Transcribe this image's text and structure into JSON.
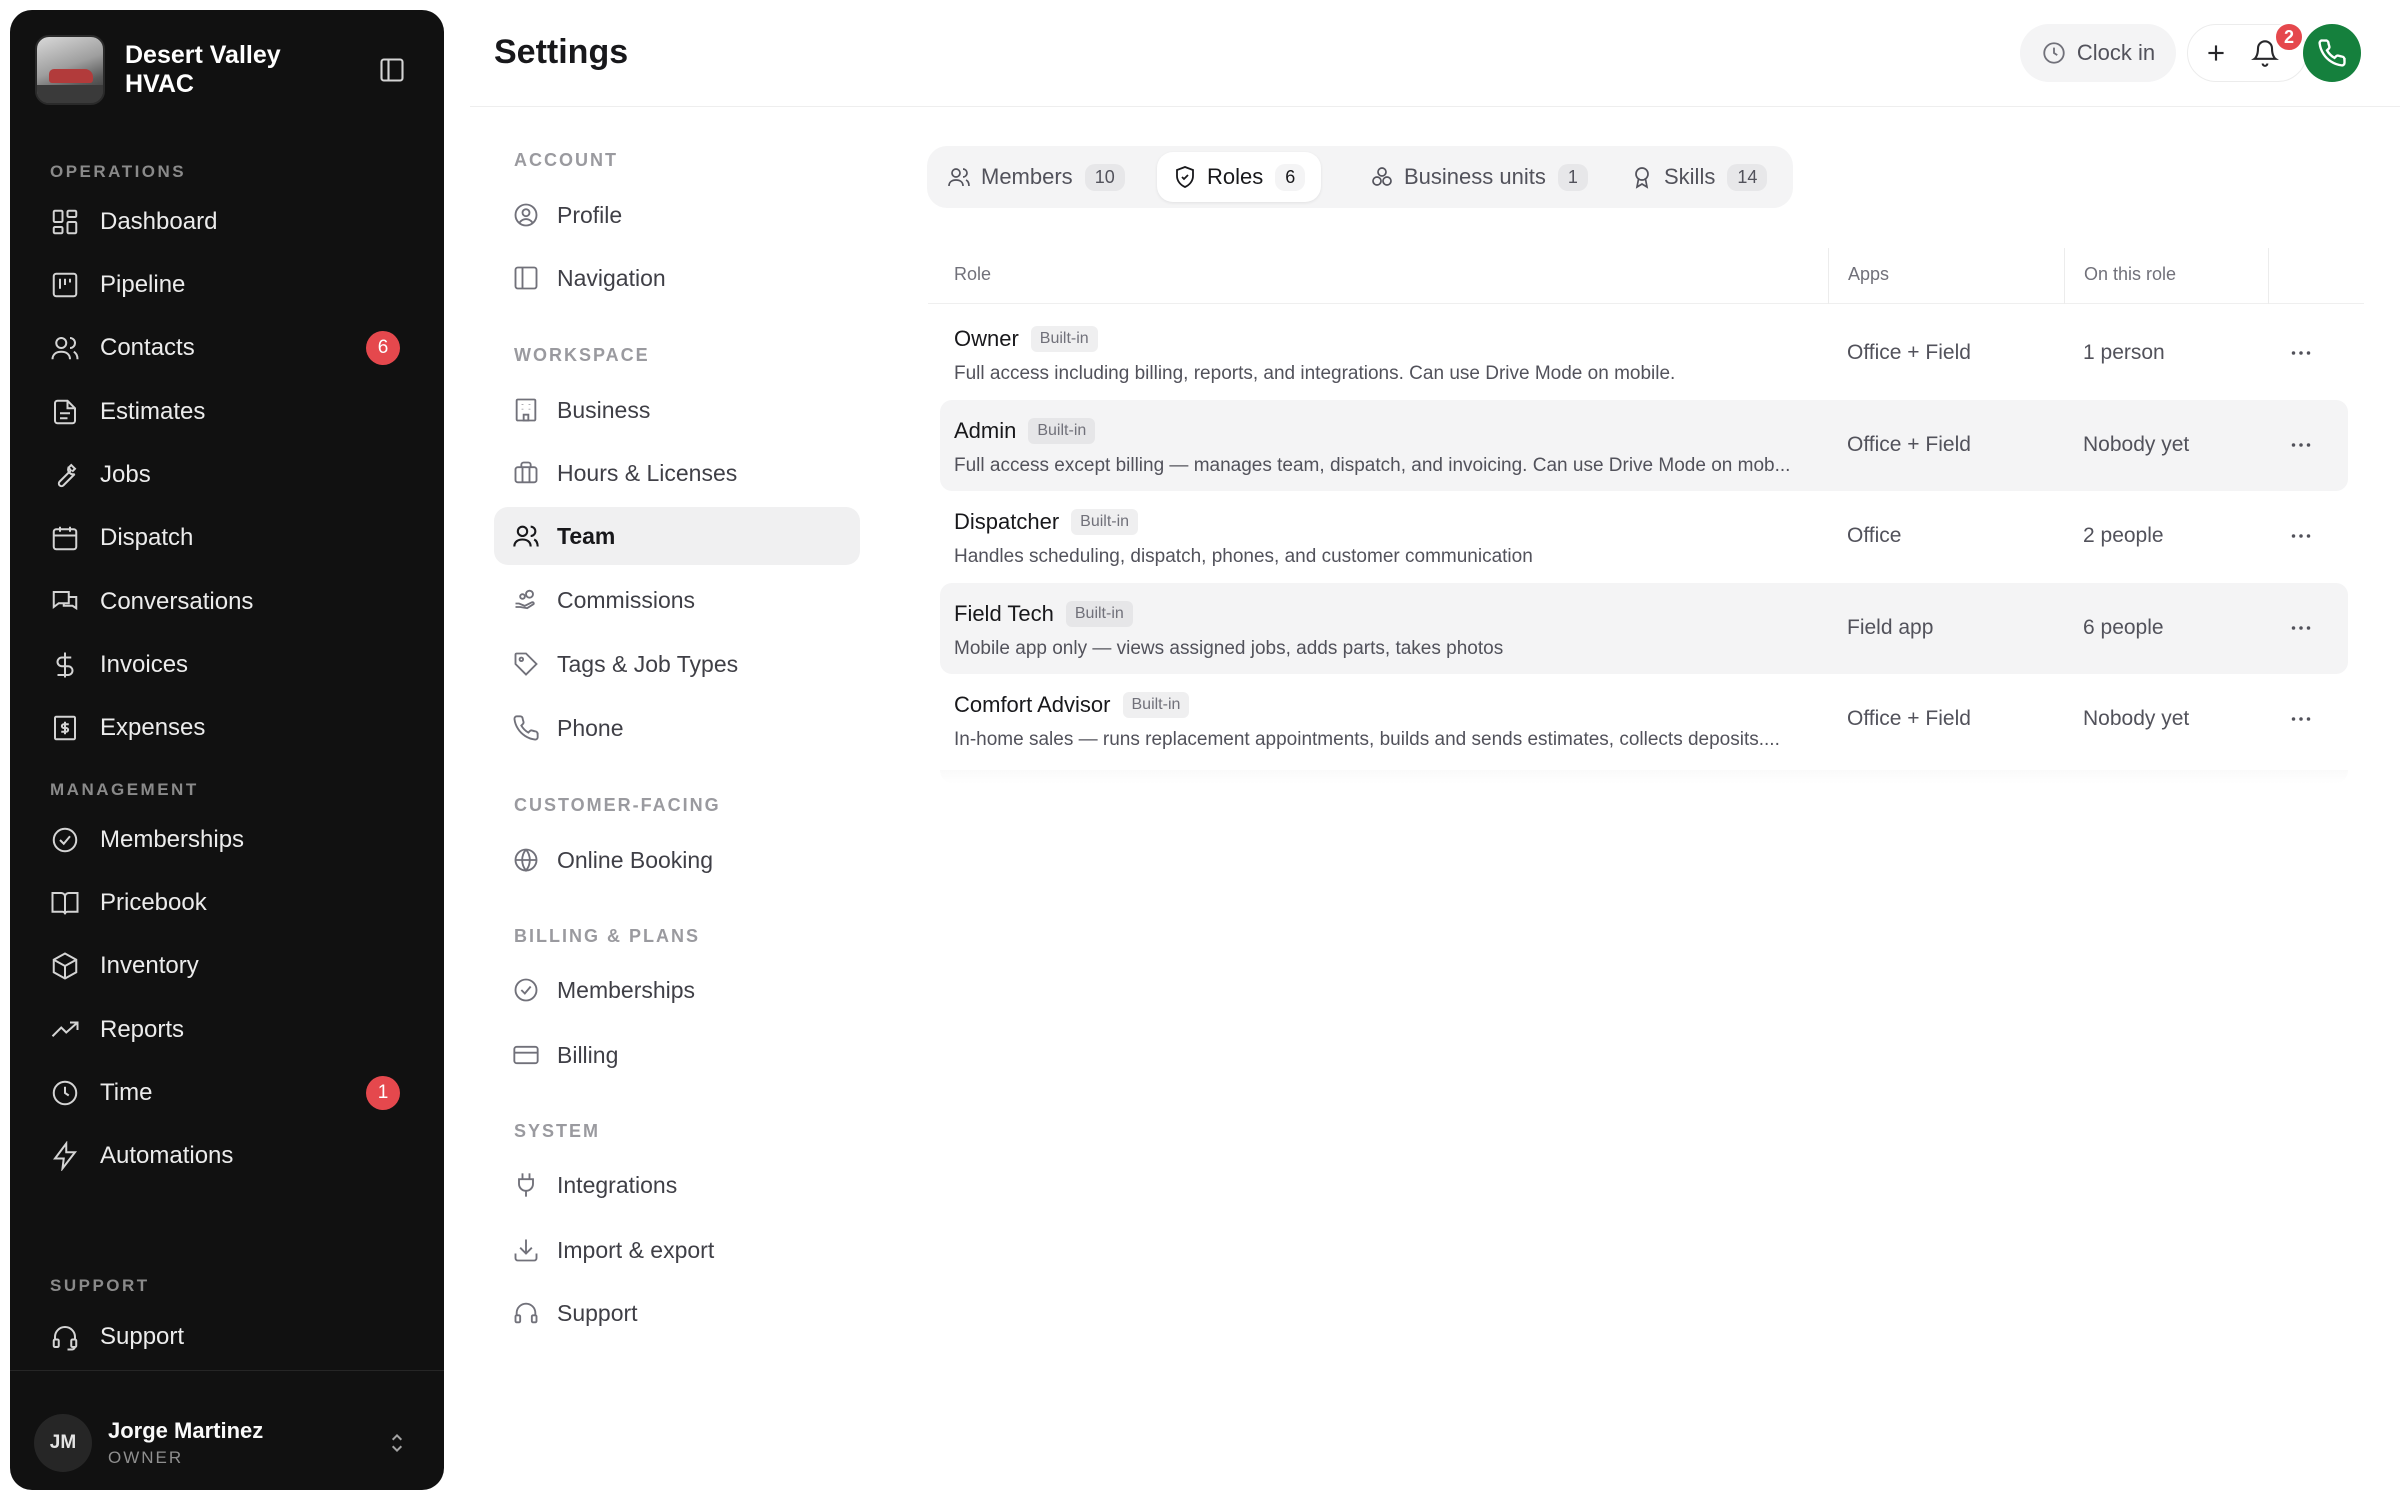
{
  "sidebar": {
    "brand_name": "Desert Valley HVAC",
    "sections": {
      "operations": "OPERATIONS",
      "management": "MANAGEMENT",
      "support": "SUPPORT"
    },
    "items": {
      "dashboard": "Dashboard",
      "pipeline": "Pipeline",
      "contacts": "Contacts",
      "contacts_badge": "6",
      "estimates": "Estimates",
      "jobs": "Jobs",
      "dispatch": "Dispatch",
      "conversations": "Conversations",
      "invoices": "Invoices",
      "expenses": "Expenses",
      "memberships": "Memberships",
      "pricebook": "Pricebook",
      "inventory": "Inventory",
      "reports": "Reports",
      "time": "Time",
      "time_badge": "1",
      "automations": "Automations",
      "support": "Support"
    },
    "user": {
      "initials": "JM",
      "name": "Jorge Martinez",
      "role": "OWNER"
    }
  },
  "header": {
    "title": "Settings",
    "clock_in": "Clock in",
    "notification_count": "2"
  },
  "settings_nav": {
    "sections": {
      "account": "ACCOUNT",
      "workspace": "WORKSPACE",
      "customer_facing": "CUSTOMER-FACING",
      "billing_plans": "BILLING & PLANS",
      "system": "SYSTEM"
    },
    "items": {
      "profile": "Profile",
      "navigation": "Navigation",
      "business": "Business",
      "hours_licenses": "Hours & Licenses",
      "team": "Team",
      "commissions": "Commissions",
      "tags_job_types": "Tags & Job Types",
      "phone": "Phone",
      "online_booking": "Online Booking",
      "memberships": "Memberships",
      "billing": "Billing",
      "integrations": "Integrations",
      "import_export": "Import & export",
      "support": "Support"
    },
    "active": "Team"
  },
  "tabs": [
    {
      "label": "Members",
      "count": "10"
    },
    {
      "label": "Roles",
      "count": "6"
    },
    {
      "label": "Business units",
      "count": "1"
    },
    {
      "label": "Skills",
      "count": "14"
    }
  ],
  "active_tab": "Roles",
  "table": {
    "columns": {
      "role": "Role",
      "apps": "Apps",
      "count": "On this role"
    },
    "rows": [
      {
        "name": "Owner",
        "tag": "Built-in",
        "description": "Full access including billing, reports, and integrations. Can use Drive Mode on mobile.",
        "apps": "Office + Field",
        "count": "1 person"
      },
      {
        "name": "Admin",
        "tag": "Built-in",
        "description": "Full access except billing — manages team, dispatch, and invoicing. Can use Drive Mode on mob...",
        "apps": "Office + Field",
        "count": "Nobody yet"
      },
      {
        "name": "Dispatcher",
        "tag": "Built-in",
        "description": "Handles scheduling, dispatch, phones, and customer communication",
        "apps": "Office",
        "count": "2 people"
      },
      {
        "name": "Field Tech",
        "tag": "Built-in",
        "description": "Mobile app only — views assigned jobs, adds parts, takes photos",
        "apps": "Field app",
        "count": "6 people"
      },
      {
        "name": "Comfort Advisor",
        "tag": "Built-in",
        "description": "In-home sales — runs replacement appointments, builds and sends estimates, collects deposits....",
        "apps": "Office + Field",
        "count": "Nobody yet"
      }
    ]
  },
  "colors": {
    "sidebar_bg": "#111111",
    "badge_red": "#e5484d",
    "phone_green": "#15803d"
  }
}
